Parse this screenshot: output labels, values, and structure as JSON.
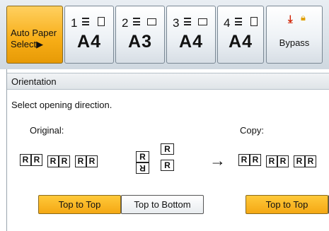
{
  "tray_bar": {
    "auto_paper_select": {
      "line1": "Auto Paper",
      "line2": "Select▶"
    },
    "trays": [
      {
        "number": "1",
        "size": "A4",
        "orientation": "portrait"
      },
      {
        "number": "2",
        "size": "A3",
        "orientation": "landscape"
      },
      {
        "number": "3",
        "size": "A4",
        "orientation": "landscape"
      },
      {
        "number": "4",
        "size": "A4",
        "orientation": "portrait"
      }
    ],
    "bypass": {
      "label": "Bypass",
      "icon": "download-arrow-icon",
      "lock_icon": "lock-icon"
    }
  },
  "dialog": {
    "title": "Orientation",
    "instruction": "Select opening direction.",
    "original_label": "Original:",
    "copy_label": "Copy:",
    "page_letter": "R",
    "arrow": "→",
    "original_buttons": [
      {
        "label": "Top to Top",
        "selected": true
      },
      {
        "label": "Top to Bottom",
        "selected": false
      }
    ],
    "copy_buttons": [
      {
        "label": "Top to Top",
        "selected": true
      }
    ]
  },
  "colors": {
    "selected_button": "#f4a814",
    "unselected_button": "#f0f2f4",
    "tray_bar_bg": "#dfe5eb"
  }
}
